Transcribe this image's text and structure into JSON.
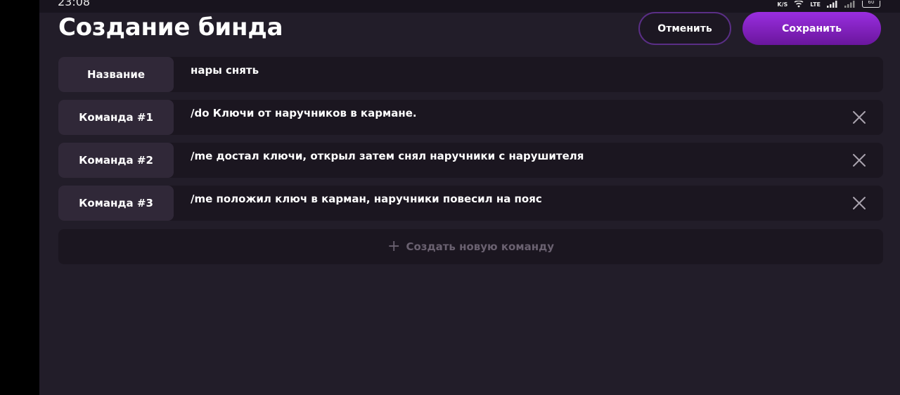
{
  "status_bar": {
    "time": "23:08",
    "speed_unit": "K/S",
    "network": "LTE",
    "battery": "60"
  },
  "header": {
    "title": "Создание бинда",
    "cancel_label": "Отменить",
    "save_label": "Сохранить"
  },
  "name_field": {
    "label": "Название",
    "value": "нары снять"
  },
  "commands": [
    {
      "label": "Команда #1",
      "value": "/do Ключи от наручников в кармане."
    },
    {
      "label": "Команда #2",
      "value": "/me достал ключи, открыл затем снял наручники с нарушителя"
    },
    {
      "label": "Команда #3",
      "value": "/me положил ключ в карман, наручники повесил на пояс"
    }
  ],
  "add_command": {
    "label": "Создать новую команду",
    "icon": "plus-icon"
  },
  "colors": {
    "background": "#221d29",
    "row_background": "#1b1620",
    "label_background": "#302838",
    "accent": "#8b24cc",
    "cancel_border": "#5a2e86",
    "muted_text": "#6a6170"
  }
}
